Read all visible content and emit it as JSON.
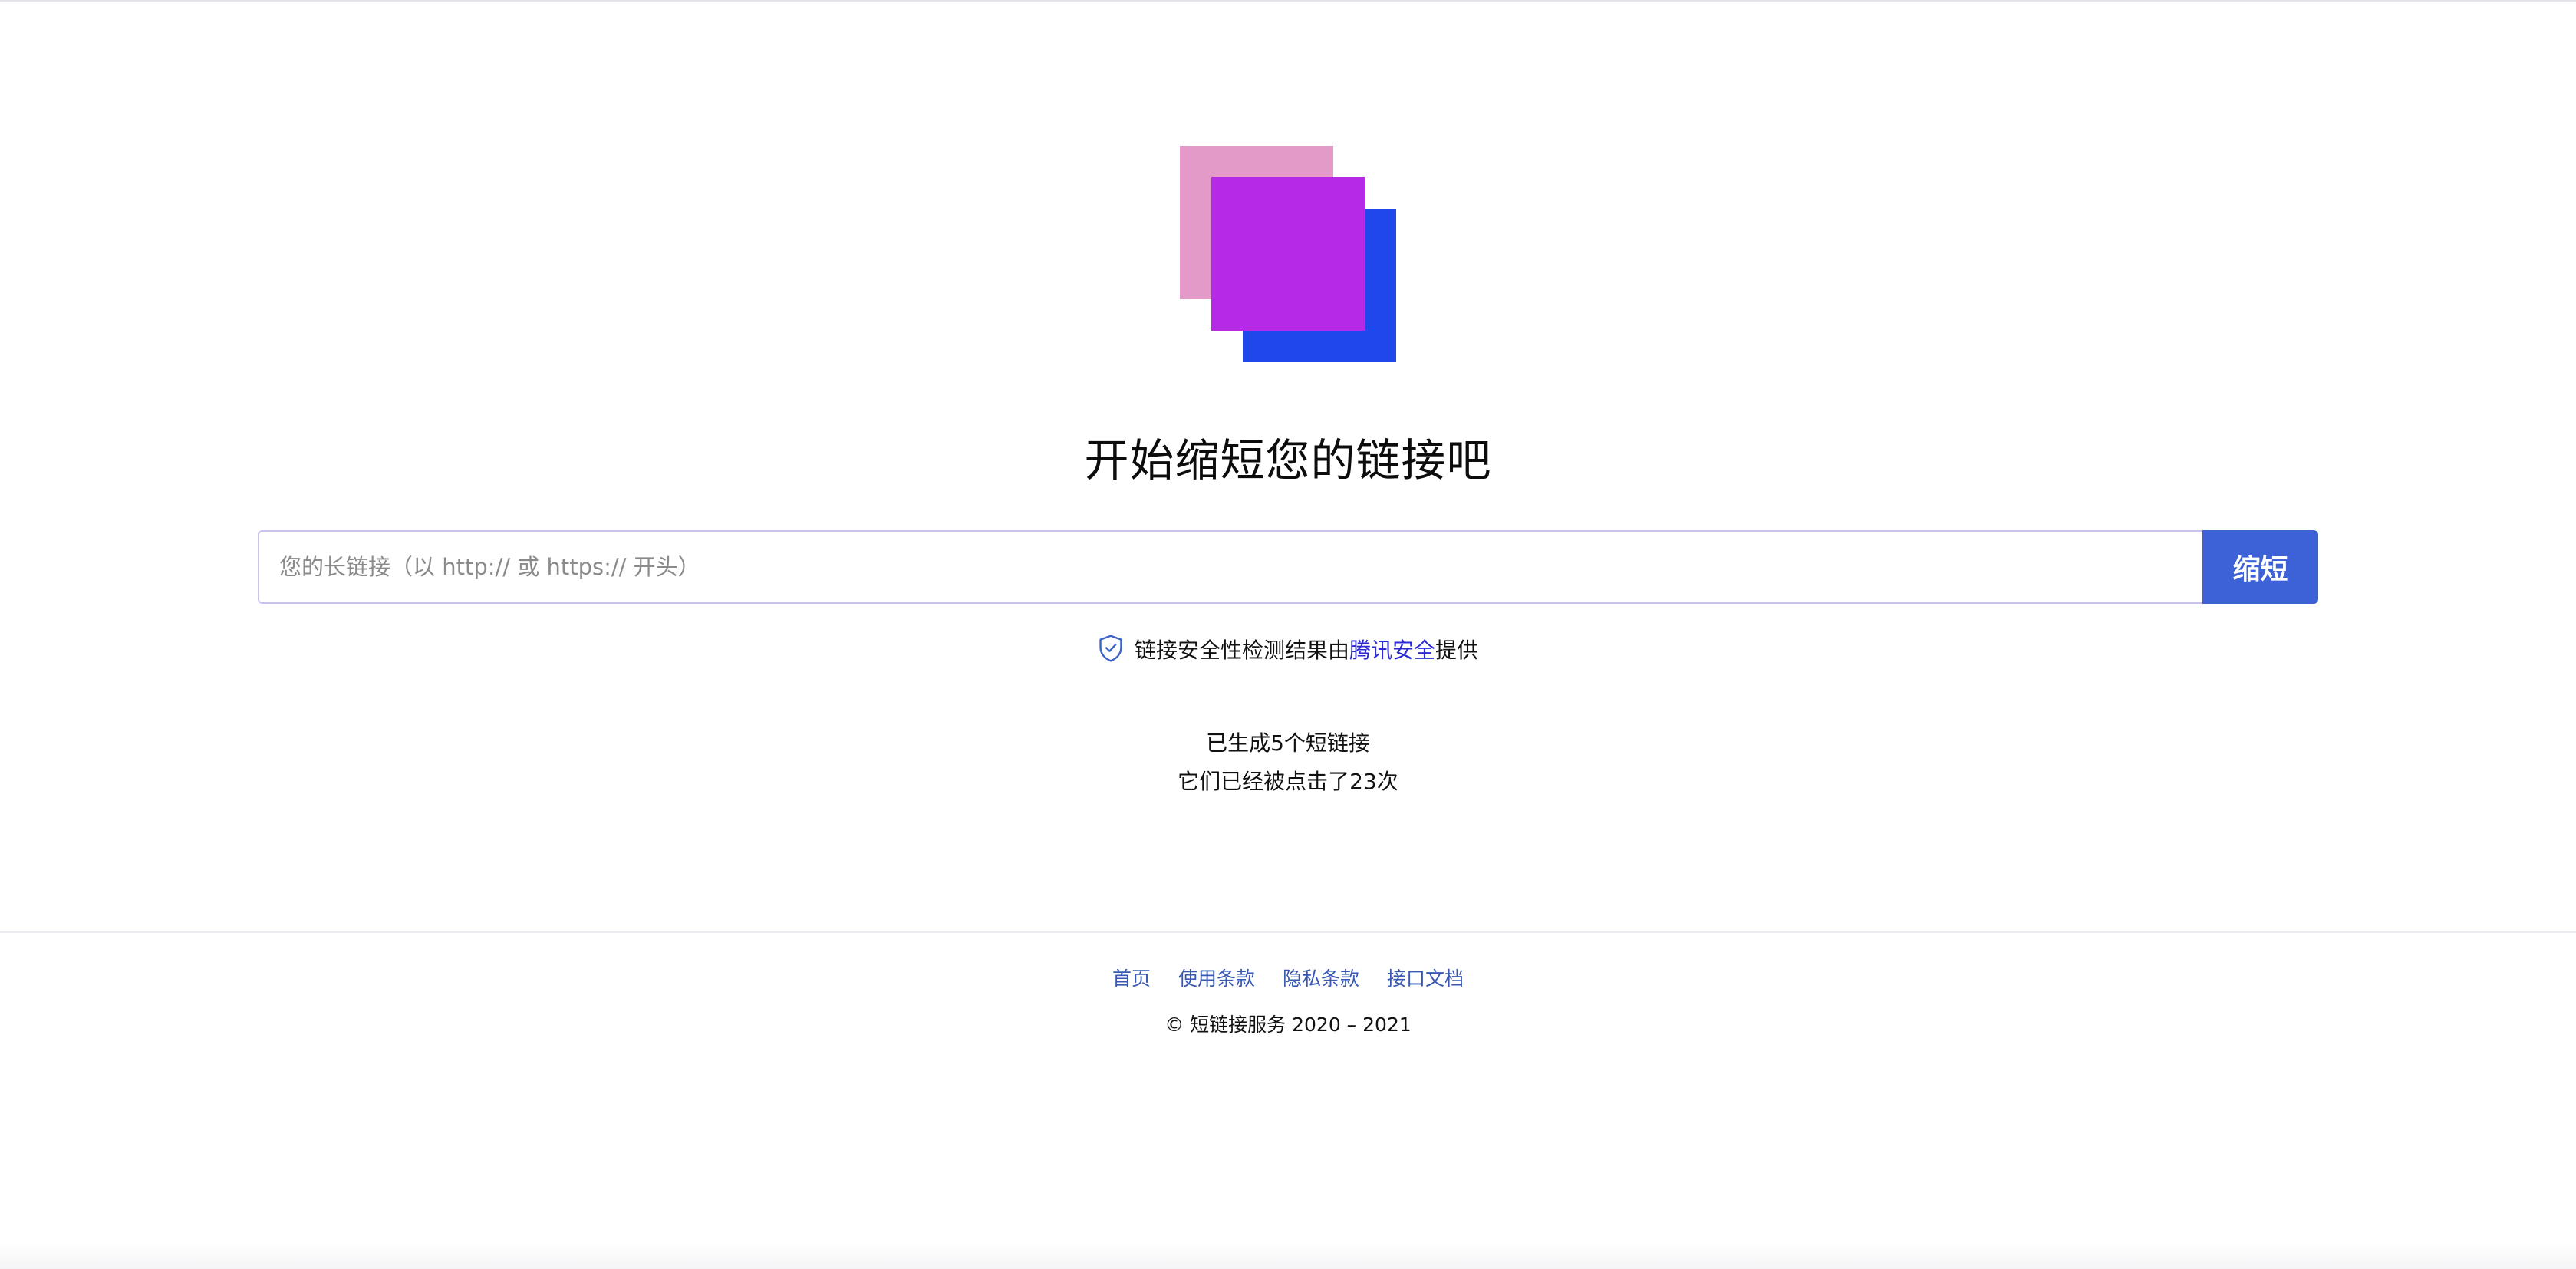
{
  "header": {
    "title": "开始缩短您的链接吧"
  },
  "logo": {
    "colors": {
      "back": "#e39ac9",
      "middle": "#b629e6",
      "front": "#2047ec"
    }
  },
  "form": {
    "placeholder": "您的长链接（以 http:// 或 https:// 开头）",
    "value": "",
    "button_label": "缩短",
    "accent_color": "#3d62d8"
  },
  "security": {
    "icon": "shield-check-icon",
    "prefix": "链接安全性检测结果由",
    "provider": "腾讯安全",
    "suffix": "提供"
  },
  "stats": {
    "generated_text": "已生成5个短链接",
    "clicked_text": "它们已经被点击了23次"
  },
  "footer": {
    "links": [
      {
        "label": "首页"
      },
      {
        "label": "使用条款"
      },
      {
        "label": "隐私条款"
      },
      {
        "label": "接口文档"
      }
    ],
    "copyright": "© 短链接服务 2020 – 2021"
  }
}
